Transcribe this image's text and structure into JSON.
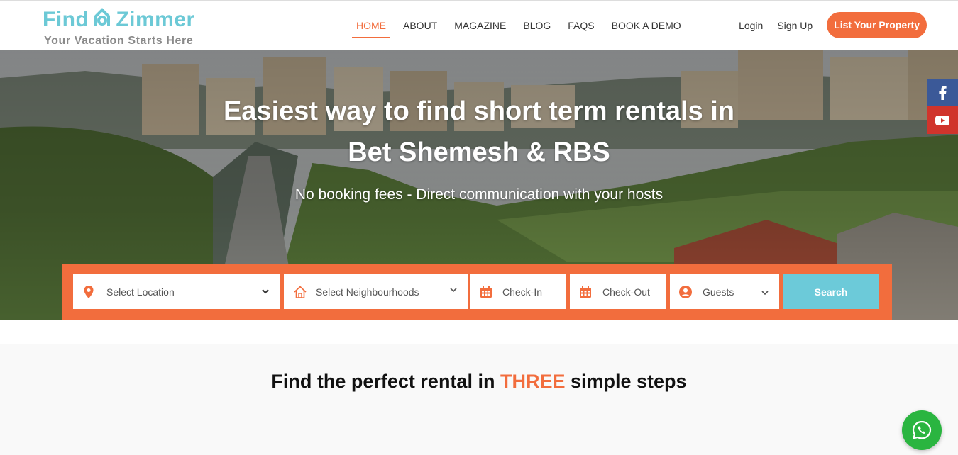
{
  "brand": {
    "name_part1": "Find",
    "name_part2": "Zimmer",
    "tagline": "Your Vacation Starts Here",
    "logo_color": "#6cc9d6"
  },
  "nav": {
    "items": [
      {
        "label": "HOME",
        "active": true
      },
      {
        "label": "ABOUT",
        "active": false
      },
      {
        "label": "MAGAZINE",
        "active": false
      },
      {
        "label": "BLOG",
        "active": false
      },
      {
        "label": "FAQS",
        "active": false
      },
      {
        "label": "BOOK A DEMO",
        "active": false
      }
    ],
    "login": "Login",
    "signup": "Sign Up",
    "list_property": "List Your Property"
  },
  "hero": {
    "title_line1": "Easiest way to find short term rentals in",
    "title_line2": "Bet Shemesh & RBS",
    "subtitle": "No booking fees - Direct communication with your hosts"
  },
  "social": {
    "facebook_icon": "facebook-icon",
    "youtube_icon": "youtube-icon"
  },
  "search": {
    "location": "Select Location",
    "neighbourhoods": "Select Neighbourhoods",
    "check_in": "Check-In",
    "check_out": "Check-Out",
    "guests": "Guests",
    "button": "Search"
  },
  "steps": {
    "title_pre": "Find the perfect rental in",
    "title_highlight": "THREE",
    "title_post": "simple steps"
  },
  "colors": {
    "accent": "#f26d3d",
    "teal": "#6ccad9",
    "facebook": "#3b5998",
    "youtube": "#d0342c",
    "whatsapp": "#2ab540"
  }
}
